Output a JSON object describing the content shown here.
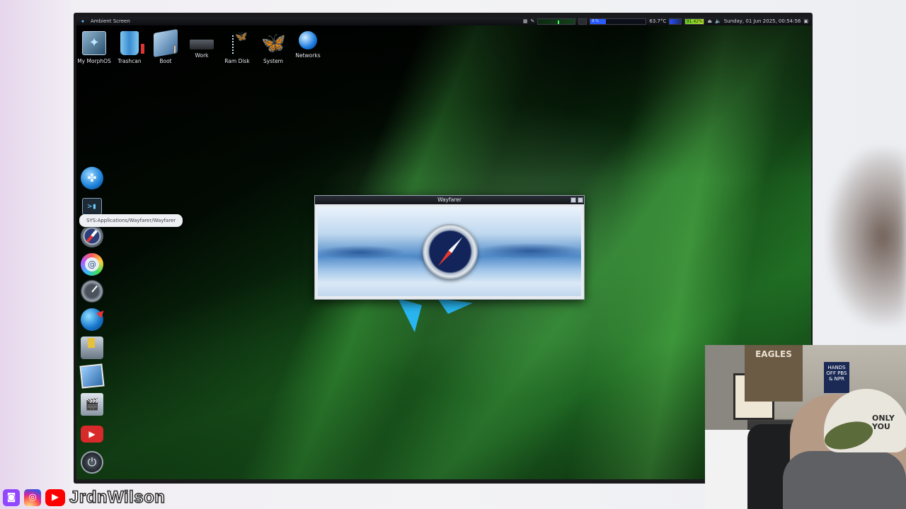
{
  "menubar": {
    "title": "Ambient Screen",
    "cpu_label": "8 %",
    "temperature": "63.7°C",
    "battery": "91.42%",
    "datetime": "Sunday, 01 Jun 2025, 00:54:56"
  },
  "desktop_icons": [
    {
      "label": "My MorphOS",
      "icon": "morphos-drive-icon"
    },
    {
      "label": "Trashcan",
      "icon": "trashcan-icon"
    },
    {
      "label": "Boot",
      "icon": "boot-drive-icon"
    },
    {
      "label": "Work",
      "icon": "work-drive-icon"
    },
    {
      "label": "Ram Disk",
      "icon": "ram-disk-icon"
    },
    {
      "label": "System",
      "icon": "system-butterfly-icon"
    },
    {
      "label": "Networks",
      "icon": "networks-globe-icon"
    }
  ],
  "dock": {
    "tooltip": "SYS:Applications/Wayfarer/Wayfarer",
    "items": [
      "ambient-butterfly-icon",
      "shell-icon",
      "wayfarer-compass-icon",
      "mail-icon",
      "clock-icon",
      "internet-globe-icon",
      "installer-icon",
      "photos-icon",
      "video-icon",
      "youtube-icon",
      "power-icon"
    ]
  },
  "wayfarer": {
    "title": "Wayfarer"
  },
  "overlay": {
    "handle": "JrdnWilson",
    "cam_poster": "EAGLES",
    "cam_sign": "HANDS OFF PBS & NPR",
    "cam_hat": "ONLY YOU"
  },
  "colors": {
    "menubar": "#0d0e11",
    "accent_blue": "#2a5cff",
    "battery_green": "#b4e22a"
  }
}
